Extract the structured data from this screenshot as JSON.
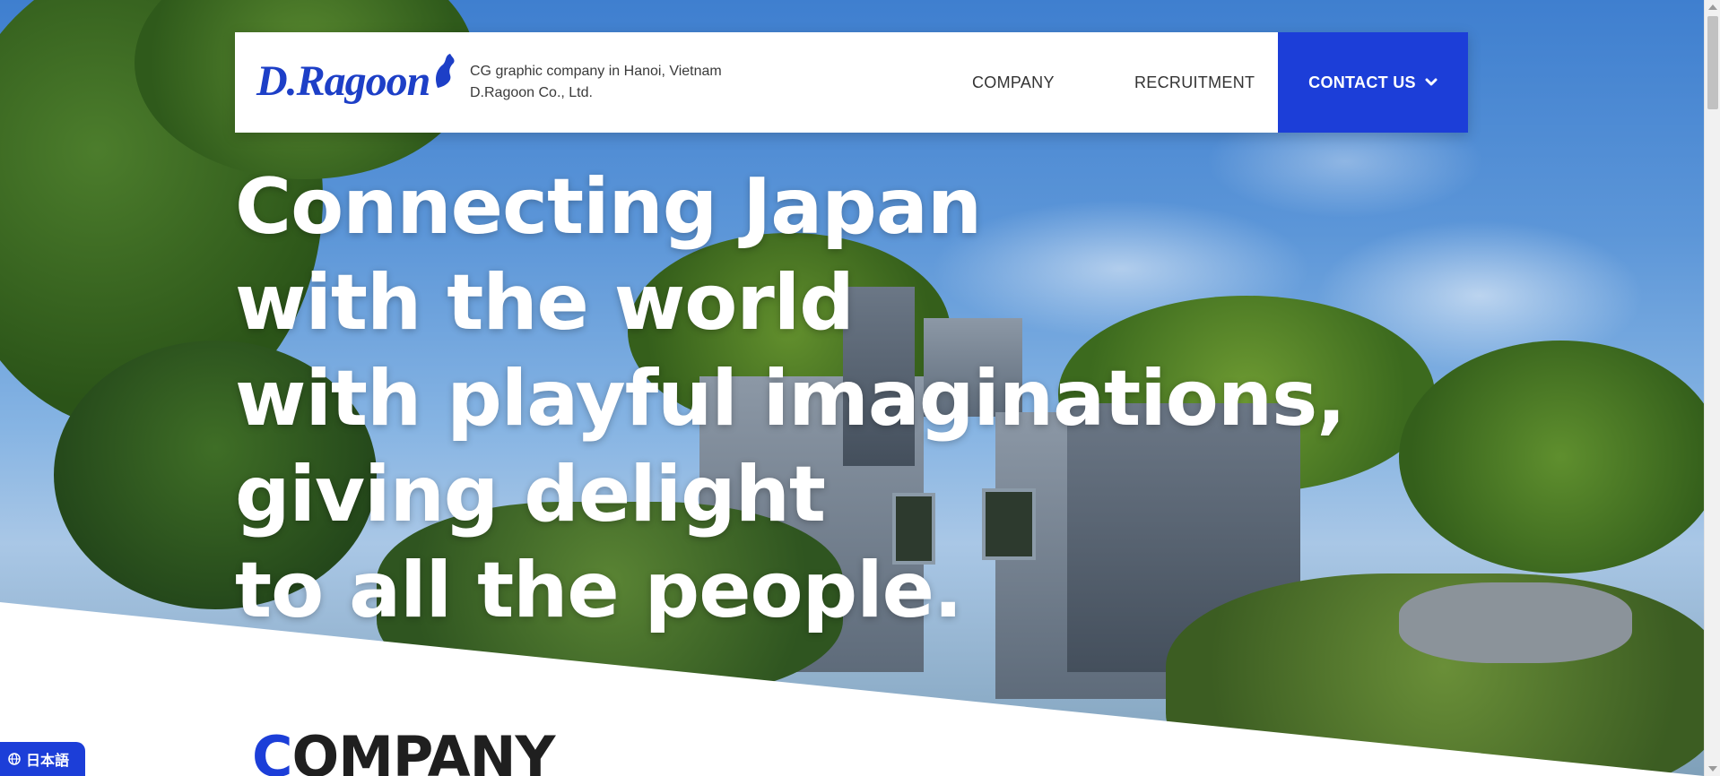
{
  "header": {
    "logo_text": "D.Ragoon",
    "tagline_line1": "CG graphic company in Hanoi, Vietnam",
    "tagline_line2": "D.Ragoon Co., Ltd.",
    "nav": {
      "company": "COMPANY",
      "recruitment": "RECRUITMENT",
      "contact": "CONTACT US"
    }
  },
  "hero": {
    "lines": [
      "Connecting Japan",
      "with the world",
      "with playful imaginations,",
      "giving delight",
      "to all the people."
    ]
  },
  "section": {
    "title_accent": "C",
    "title_rest": "OMPANY"
  },
  "language_badge": {
    "label": "日本語",
    "icon": "globe-icon"
  },
  "colors": {
    "brand_blue": "#1c3ed8",
    "headline": "#ffffff",
    "text_dark": "#1f1f1f"
  }
}
